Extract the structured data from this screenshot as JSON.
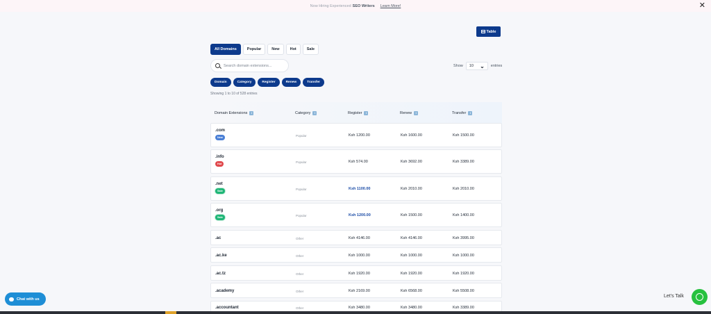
{
  "announcement": {
    "text": "Now Hiring Experienced",
    "bold": "SEO Writers",
    "link": "Learn More!",
    "close": "✕"
  },
  "view_toggle": {
    "label": "Table",
    "icon": "table-icon"
  },
  "filters": [
    "All Domains",
    "Popular",
    "New",
    "Hot",
    "Sale"
  ],
  "active_filter": "All Domains",
  "entries": {
    "show_label": "Show",
    "value": "10",
    "suffix": "entries"
  },
  "search": {
    "placeholder": "Search domain extensions..."
  },
  "sort_buttons": [
    "Domain",
    "Category",
    "Register",
    "Renew",
    "Transfer"
  ],
  "showing_text": "Showing 1 to 10 of 528 entries",
  "columns": [
    "Domain Extensions",
    "Category",
    "Register",
    "Renew",
    "Transfer"
  ],
  "rows": [
    {
      "ext": ".com",
      "badge": "New",
      "category": "Popular",
      "register": "Ksh 1200.00",
      "renew": "Ksh 1600.00",
      "transfer": "Ksh 1500.00"
    },
    {
      "ext": ".info",
      "badge": "Hot",
      "category": "Popular",
      "register": "Ksh 574.00",
      "renew": "Ksh 3692.00",
      "transfer": "Ksh 3389.00"
    },
    {
      "ext": ".net",
      "badge": "Sale",
      "category": "Popular",
      "register": "Ksh 1100.00",
      "renew": "Ksh 2010.00",
      "transfer": "Ksh 2010.00"
    },
    {
      "ext": ".org",
      "badge": "Sale",
      "category": "Popular",
      "register": "Ksh 1200.00",
      "renew": "Ksh 1500.00",
      "transfer": "Ksh 1400.00"
    },
    {
      "ext": ".ac",
      "badge": "",
      "category": "Other",
      "register": "Ksh 4146.00",
      "renew": "Ksh 4146.00",
      "transfer": "Ksh 3995.00"
    },
    {
      "ext": ".ac.ke",
      "badge": "",
      "category": "Other",
      "register": "Ksh 1000.00",
      "renew": "Ksh 1000.00",
      "transfer": "Ksh 1000.00"
    },
    {
      "ext": ".ac.tz",
      "badge": "",
      "category": "Other",
      "register": "Ksh 1920.00",
      "renew": "Ksh 1920.00",
      "transfer": "Ksh 1920.00"
    },
    {
      "ext": ".academy",
      "badge": "",
      "category": "Other",
      "register": "Ksh 2169.00",
      "renew": "Ksh 6568.00",
      "transfer": "Ksh 5508.00"
    },
    {
      "ext": ".accountant",
      "badge": "",
      "category": "Other",
      "register": "Ksh 3480.00",
      "renew": "Ksh 3480.00",
      "transfer": "Ksh 3389.00"
    }
  ],
  "chat_button": "Chat with us",
  "lets_talk": "Let's Talk",
  "colors": {
    "primary": "#0d3a8c",
    "new": "#4a7fd6",
    "hot": "#e0484c",
    "sale": "#1fb677",
    "chat": "#1e8ed6",
    "whatsapp": "#27c13f"
  }
}
